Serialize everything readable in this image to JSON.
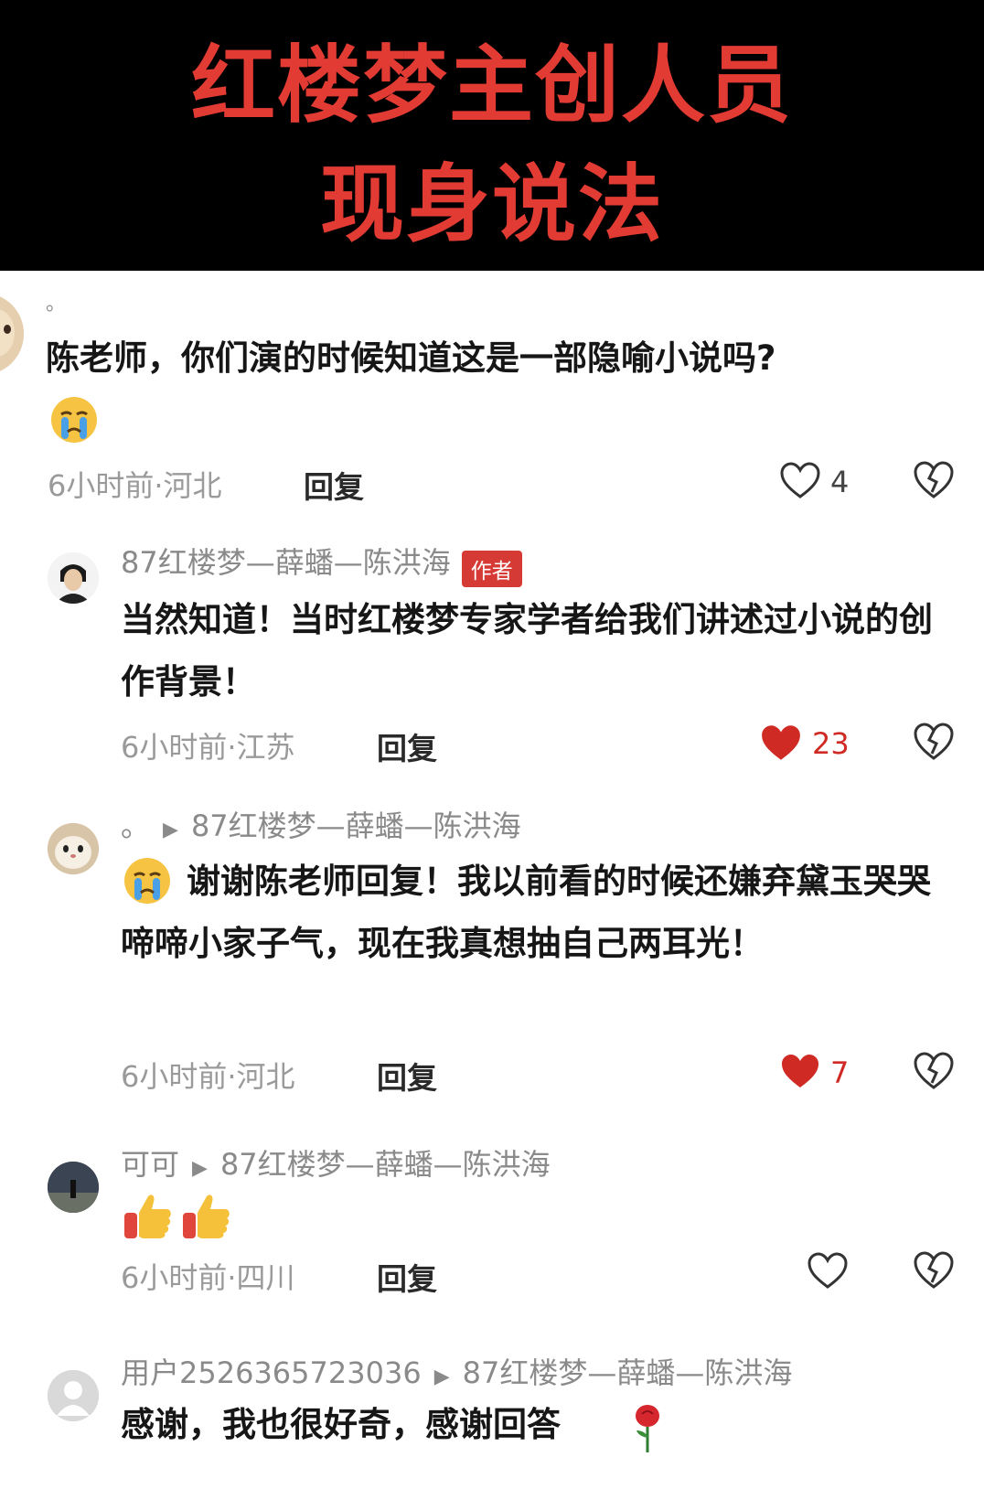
{
  "banner": {
    "line1": "红楼梦主创人员",
    "line2": "现身说法"
  },
  "colors": {
    "banner_bg": "#000000",
    "banner_text": "#e23b33",
    "liked_heart": "#d02a25",
    "author_badge": "#d63a35"
  },
  "comments": [
    {
      "username": "。",
      "text": "陈老师，你们演的时候知道这是一部隐喻小说吗?",
      "emoji": "crying-face",
      "time_location": "6小时前·河北",
      "reply_label": "回复",
      "likes": "4",
      "liked": false
    },
    {
      "username": "87红楼梦—薛蟠—陈洪海",
      "badge": "作者",
      "text": "当然知道！当时红楼梦专家学者给我们讲述过小说的创作背景！",
      "time_location": "6小时前·江苏",
      "reply_label": "回复",
      "likes": "23",
      "liked": true
    },
    {
      "username": "。",
      "reply_to": "87红楼梦—薛蟠—陈洪海",
      "emoji": "crying-face",
      "text": "谢谢陈老师回复！我以前看的时候还嫌弃黛玉哭哭啼啼小家子气，现在我真想抽自己两耳光！",
      "time_location": "6小时前·河北",
      "reply_label": "回复",
      "likes": "7",
      "liked": true
    },
    {
      "username": "可可",
      "reply_to": "87红楼梦—薛蟠—陈洪海",
      "emoji": "thumbs-up x2",
      "time_location": "6小时前·四川",
      "reply_label": "回复",
      "liked": false
    },
    {
      "username": "用户2526365723036",
      "reply_to": "87红楼梦—薛蟠—陈洪海",
      "text": "感谢，我也很好奇，感谢回答",
      "emoji": "rose"
    }
  ]
}
